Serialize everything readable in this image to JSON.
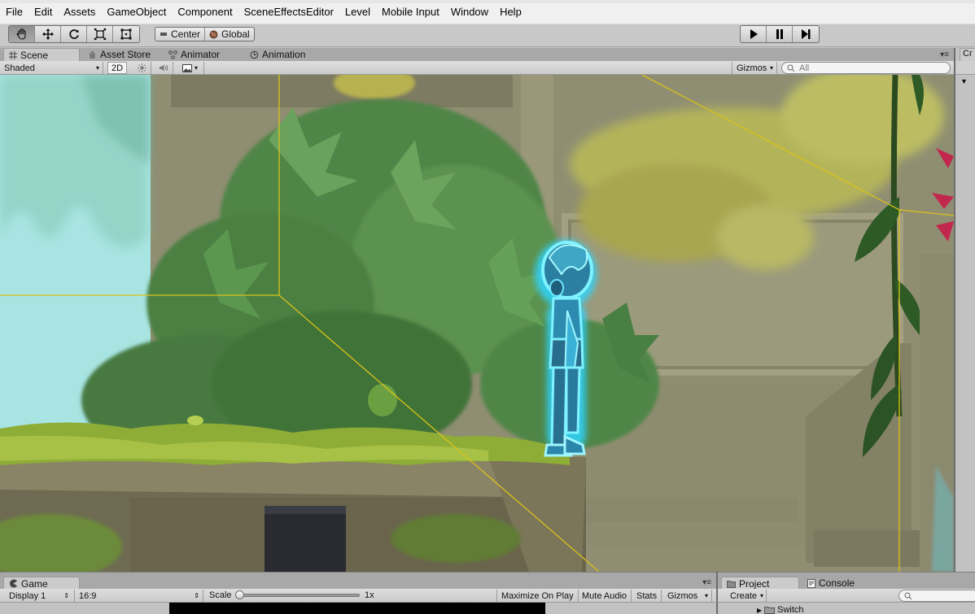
{
  "menu": {
    "items": [
      "File",
      "Edit",
      "Assets",
      "GameObject",
      "Component",
      "SceneEffectsEditor",
      "Level",
      "Mobile Input",
      "Window",
      "Help"
    ]
  },
  "toolbar": {
    "tools": [
      "hand-icon",
      "move-icon",
      "rotate-icon",
      "scale-icon",
      "rect-tool-icon"
    ],
    "active_tool": "hand-icon",
    "pivot_label": "Center",
    "space_label": "Global",
    "play_buttons": [
      "play-icon",
      "pause-icon",
      "step-icon"
    ]
  },
  "scene_tabs": {
    "scene": "Scene",
    "asset_store": "Asset Store",
    "animator": "Animator",
    "animation": "Animation"
  },
  "scene_bar": {
    "shading": "Shaded",
    "mode_2d": "2D",
    "gizmos": "Gizmos",
    "search_placeholder": "All"
  },
  "inspector_tab": "Cr",
  "game_panel": {
    "tab": "Game",
    "display": "Display 1",
    "aspect": "16:9",
    "scale_label": "Scale",
    "scale_value": "1x",
    "maximize": "Maximize On Play",
    "mute": "Mute Audio",
    "stats": "Stats",
    "gizmos": "Gizmos"
  },
  "project_panel": {
    "project_tab": "Project",
    "console_tab": "Console",
    "create": "Create",
    "tree_item": "Switch"
  },
  "colors": {
    "camera_guides": "#d9c21a",
    "character_glow": "#2fd4ff",
    "sky": "#9fe3e6"
  }
}
